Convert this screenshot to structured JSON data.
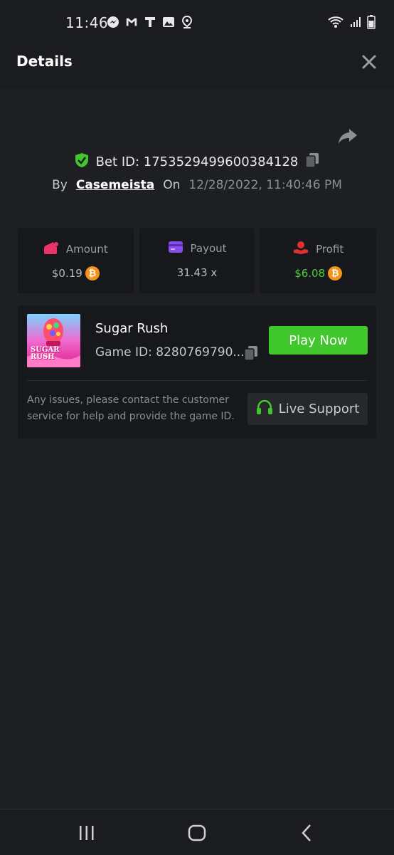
{
  "status_bar": {
    "time": "11:46",
    "icons": [
      "messenger-icon",
      "gmail-icon",
      "t-app-icon",
      "image-icon",
      "location-icon"
    ],
    "right_icons": [
      "wifi-icon",
      "signal-icon",
      "battery-icon"
    ]
  },
  "header": {
    "title": "Details",
    "close_icon": "close-icon"
  },
  "bet": {
    "id_label": "Bet ID: 1753529499600384128",
    "by_label": "By",
    "user": "Casemeista",
    "on_label": "On",
    "date": "12/28/2022, 11:40:46 PM"
  },
  "stats": [
    {
      "label": "Amount",
      "value": "$0.19",
      "icon": "wallet-icon",
      "currency_icon": "bitcoin-icon"
    },
    {
      "label": "Payout",
      "value": "31.43 x",
      "icon": "card-icon"
    },
    {
      "label": "Profit",
      "value": "$6.08",
      "icon": "hand-coin-icon",
      "currency_icon": "bitcoin-icon"
    }
  ],
  "game": {
    "name": "Sugar Rush",
    "game_id": "Game ID: 8280769790...",
    "thumb_title_line1": "SUGAR",
    "thumb_title_line2": "RUSH",
    "play_label": "Play Now",
    "notice": "Any issues, please contact the customer service for help and provide the game ID.",
    "support_label": "Live Support"
  },
  "colors": {
    "background": "#1e1f22",
    "panel": "#17181b",
    "accent_green": "#3fc72b",
    "profit_green": "#4cd137",
    "bitcoin_orange": "#f7931a"
  }
}
